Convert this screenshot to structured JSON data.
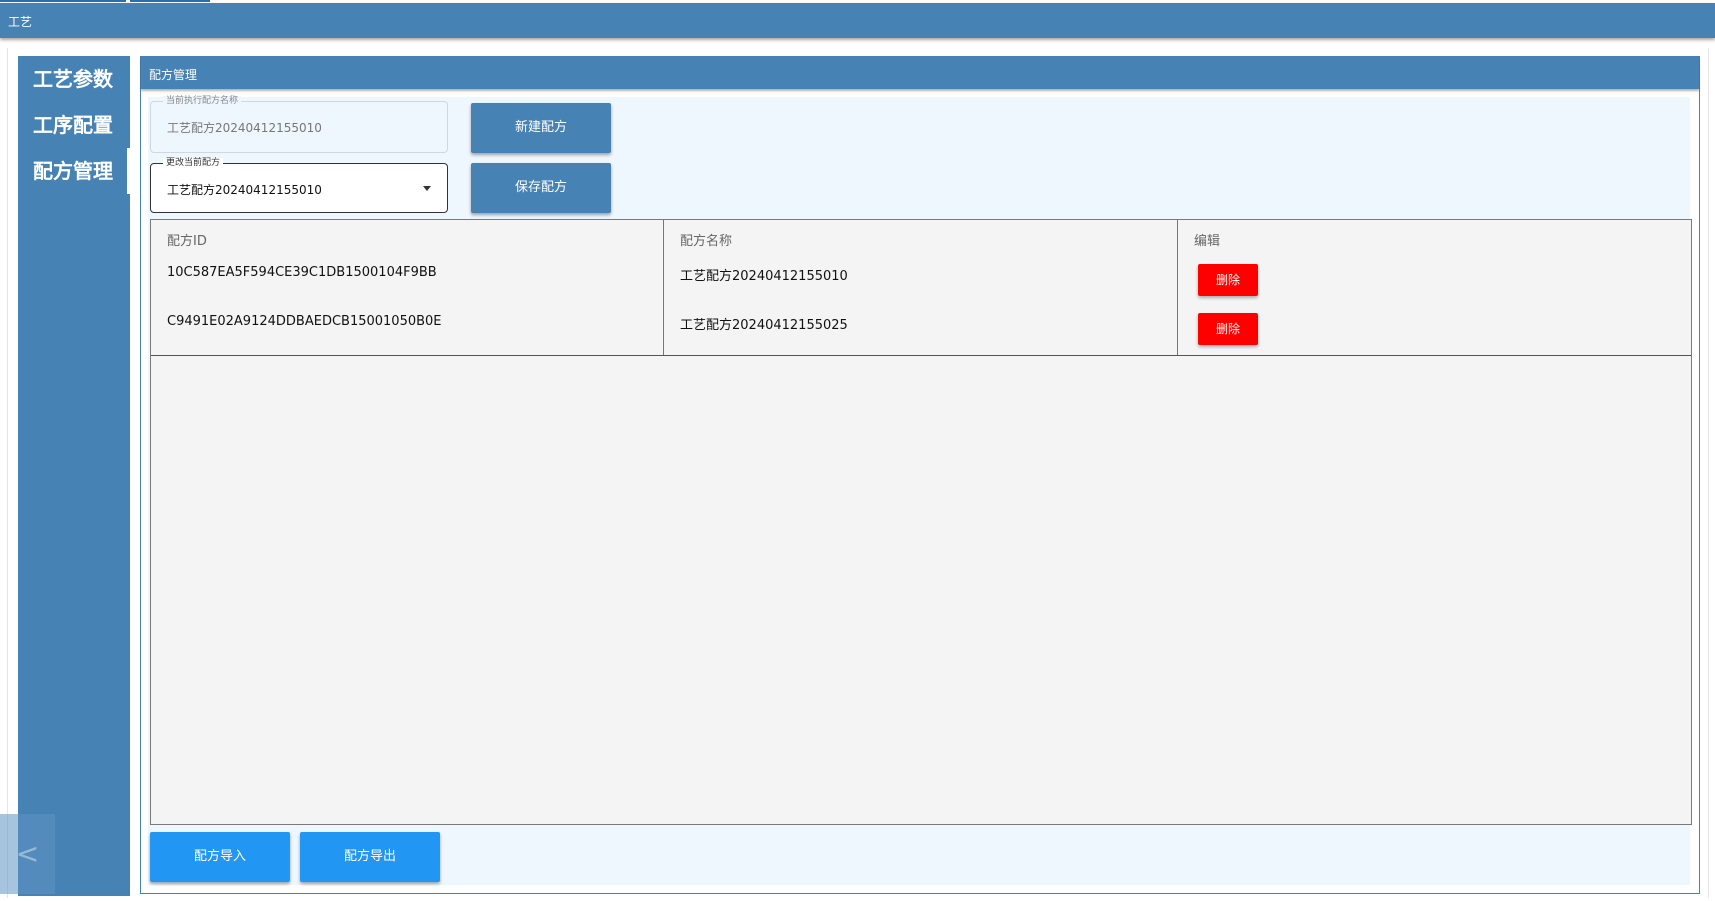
{
  "window": {
    "title": "工艺"
  },
  "sidebar": {
    "items": [
      {
        "label": "工艺参数"
      },
      {
        "label": "工序配置"
      },
      {
        "label": "配方管理"
      }
    ],
    "collapse_icon": "chevron-left-icon",
    "collapse_glyph": "<"
  },
  "panel": {
    "title": "配方管理",
    "current_recipe": {
      "label": "当前执行配方名称",
      "value": "工艺配方20240412155010"
    },
    "change_recipe": {
      "label": "更改当前配方",
      "value": "工艺配方20240412155010"
    },
    "new_button": "新建配方",
    "save_button": "保存配方",
    "import_button": "配方导入",
    "export_button": "配方导出"
  },
  "table": {
    "columns": [
      "配方ID",
      "配方名称",
      "编辑"
    ],
    "rows": [
      {
        "id": "10C587EA5F594CE39C1DB1500104F9BB",
        "name": "工艺配方20240412155010",
        "action": "删除"
      },
      {
        "id": "C9491E02A9124DDBAEDCB15001050B0E",
        "name": "工艺配方20240412155025",
        "action": "删除"
      }
    ]
  },
  "colors": {
    "primary": "#4682b4",
    "accent": "#2196f3",
    "danger": "#ff0000",
    "panel_bg": "#eef6fe"
  }
}
